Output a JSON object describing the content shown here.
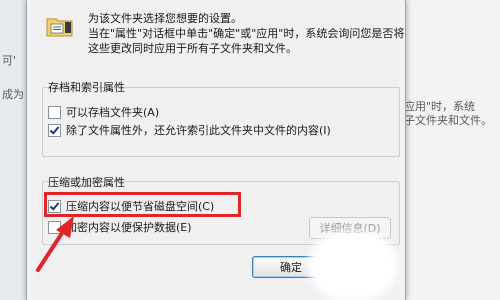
{
  "dialog": {
    "intro": "为该文件夹选择您想要的设置。\n当在\"属性\"对话框中单击\"确定\"或\"应用\"时，系统会询问您是否将这些更改同时应用于所有子文件夹和文件。",
    "archive_group": {
      "title": "存档和索引属性",
      "items": [
        {
          "label": "可以存档文件夹(A)",
          "checked": false
        },
        {
          "label": "除了文件属性外，还允许索引此文件夹中文件的内容(I)",
          "checked": true
        }
      ]
    },
    "compress_group": {
      "title": "压缩或加密属性",
      "items": [
        {
          "label": "压缩内容以便节省磁盘空间(C)",
          "checked": true
        },
        {
          "label": "加密内容以便保护数据(E)",
          "checked": false
        }
      ],
      "details_button": "详细信息(D)"
    },
    "ok_button": "确定"
  },
  "background": {
    "left_frag1": "可'",
    "left_frag2": "成为",
    "right_frag1": "应用\"时，系统",
    "right_frag2": "子文件夹和文件。"
  },
  "annotation": {
    "highlight_color": "#e0262b"
  }
}
